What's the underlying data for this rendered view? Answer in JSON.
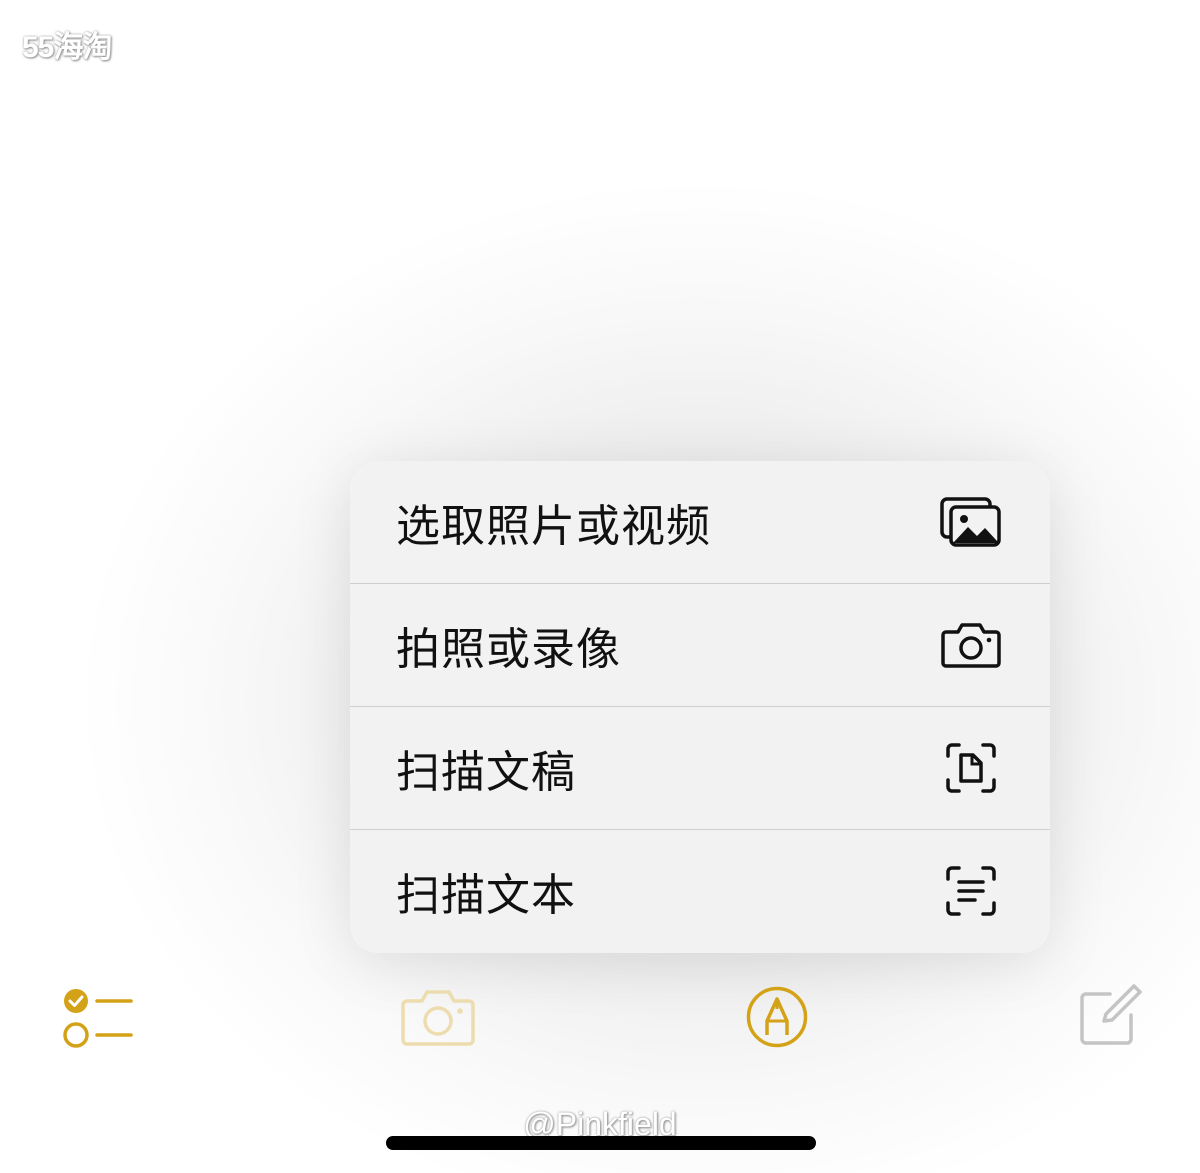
{
  "watermark_top": "55海淘",
  "watermark_bottom": "@Pinkfield",
  "menu": {
    "items": [
      {
        "label": "选取照片或视频",
        "icon": "photo-library-icon"
      },
      {
        "label": "拍照或录像",
        "icon": "camera-icon"
      },
      {
        "label": "扫描文稿",
        "icon": "scan-document-icon"
      },
      {
        "label": "扫描文本",
        "icon": "scan-text-icon"
      }
    ]
  },
  "toolbar": {
    "items": [
      {
        "icon": "checklist-icon"
      },
      {
        "icon": "camera-icon"
      },
      {
        "icon": "markup-pen-icon"
      },
      {
        "icon": "compose-icon"
      }
    ]
  },
  "colors": {
    "accent": "#d4a216",
    "accent_faded": "#ecdcae",
    "disabled_gray": "#c4c4c4",
    "menu_bg": "#f2f2f2",
    "text": "#111111"
  }
}
